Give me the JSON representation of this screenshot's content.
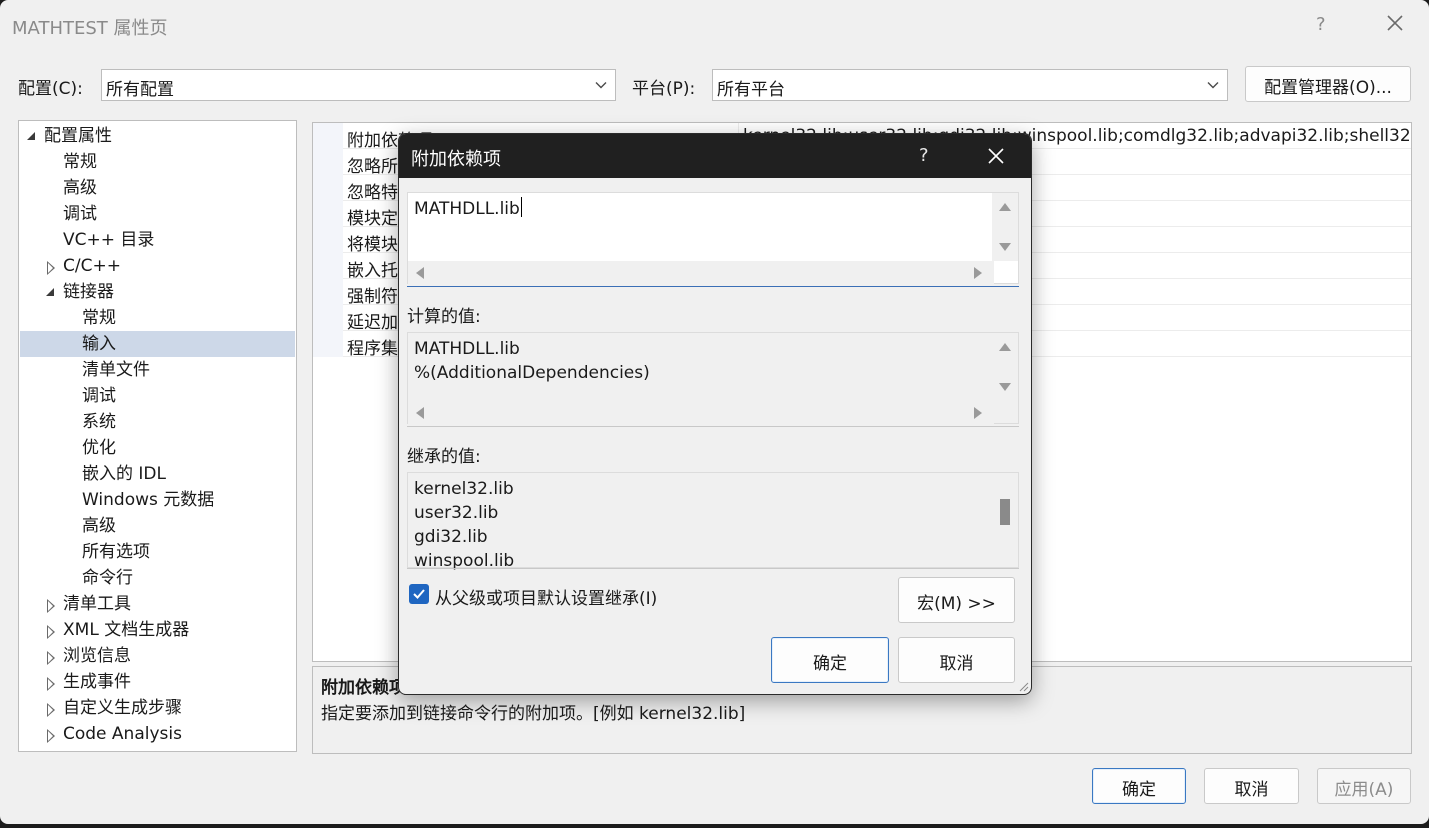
{
  "window": {
    "title": "MATHTEST 属性页",
    "help_label": "?"
  },
  "config": {
    "config_label": "配置(C):",
    "config_value": "所有配置",
    "platform_label": "平台(P):",
    "platform_value": "所有平台",
    "manager_button": "配置管理器(O)..."
  },
  "tree": {
    "items": [
      {
        "label": "配置属性",
        "state": "open"
      },
      {
        "label": "常规"
      },
      {
        "label": "高级"
      },
      {
        "label": "调试"
      },
      {
        "label": "VC++ 目录"
      },
      {
        "label": "C/C++",
        "state": "closed"
      },
      {
        "label": "链接器",
        "state": "open"
      },
      {
        "label": "常规"
      },
      {
        "label": "输入",
        "selected": true
      },
      {
        "label": "清单文件"
      },
      {
        "label": "调试"
      },
      {
        "label": "系统"
      },
      {
        "label": "优化"
      },
      {
        "label": "嵌入的 IDL"
      },
      {
        "label": "Windows 元数据"
      },
      {
        "label": "高级"
      },
      {
        "label": "所有选项"
      },
      {
        "label": "命令行"
      },
      {
        "label": "清单工具",
        "state": "closed"
      },
      {
        "label": "XML 文档生成器",
        "state": "closed"
      },
      {
        "label": "浏览信息",
        "state": "closed"
      },
      {
        "label": "生成事件",
        "state": "closed"
      },
      {
        "label": "自定义生成步骤",
        "state": "closed"
      },
      {
        "label": "Code Analysis",
        "state": "closed"
      }
    ]
  },
  "grid": {
    "rows": [
      {
        "name": "附加依赖项",
        "value": "kernel32.lib;user32.lib;gdi32.lib;winspool.lib;comdlg32.lib;advapi32.lib;shell32"
      },
      {
        "name": "忽略所",
        "value": ""
      },
      {
        "name": "忽略特",
        "value": ""
      },
      {
        "name": "模块定",
        "value": ""
      },
      {
        "name": "将模块",
        "value": ""
      },
      {
        "name": "嵌入托",
        "value": ""
      },
      {
        "name": "强制符",
        "value": ""
      },
      {
        "name": "延迟加",
        "value": ""
      },
      {
        "name": "程序集",
        "value": ""
      }
    ]
  },
  "description": {
    "title": "附加依赖项",
    "text": "指定要添加到链接命令行的附加项。[例如 kernel32.lib]"
  },
  "dialog": {
    "title": "附加依赖项",
    "help_label": "?",
    "edit_value": "MATHDLL.lib",
    "computed_label": "计算的值:",
    "computed_lines": [
      "MATHDLL.lib",
      "%(AdditionalDependencies)"
    ],
    "inherited_label": "继承的值:",
    "inherited_lines": [
      "kernel32.lib",
      "user32.lib",
      "gdi32.lib",
      "winspool.lib"
    ],
    "inherit_checkbox_label": "从父级或项目默认设置继承(I)",
    "inherit_checked": true,
    "macro_button": "宏(M) >>",
    "ok_button": "确定",
    "cancel_button": "取消"
  },
  "footer": {
    "ok_button": "确定",
    "cancel_button": "取消",
    "apply_button": "应用(A)"
  },
  "colors": {
    "accent": "#1f66c1",
    "selection": "#cdd8e8",
    "dialog_titlebar": "#202020"
  }
}
